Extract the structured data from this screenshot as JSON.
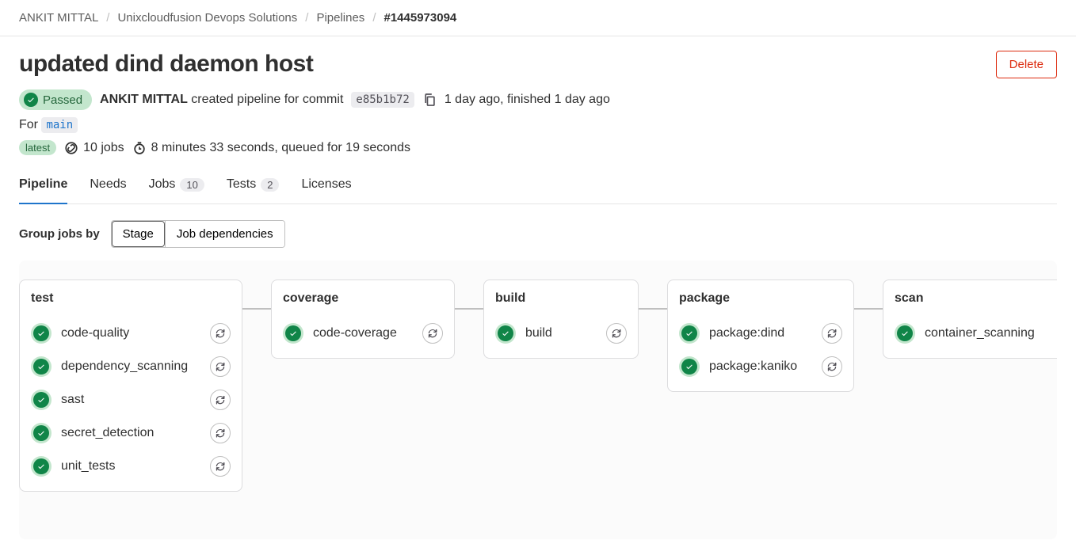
{
  "breadcrumbs": {
    "items": [
      "ANKIT MITTAL",
      "Unixcloudfusion Devops Solutions",
      "Pipelines"
    ],
    "current": "#1445973094"
  },
  "title": "updated dind daemon host",
  "delete_label": "Delete",
  "status_badge": "Passed",
  "author": "ANKIT MITTAL",
  "created_text_a": "created pipeline for commit",
  "commit_sha": "e85b1b72",
  "created_text_b": "1 day ago, finished 1 day ago",
  "for_label": "For",
  "branch": "main",
  "latest_badge": "latest",
  "jobs_count_text": "10 jobs",
  "duration_text": "8 minutes 33 seconds, queued for 19 seconds",
  "tabs": {
    "pipeline": "Pipeline",
    "needs": "Needs",
    "jobs": "Jobs",
    "jobs_count": "10",
    "tests": "Tests",
    "tests_count": "2",
    "licenses": "Licenses"
  },
  "group_by": {
    "label": "Group jobs by",
    "stage": "Stage",
    "deps": "Job dependencies"
  },
  "stages": [
    {
      "name": "test",
      "jobs": [
        "code-quality",
        "dependency_scanning",
        "sast",
        "secret_detection",
        "unit_tests"
      ]
    },
    {
      "name": "coverage",
      "jobs": [
        "code-coverage"
      ]
    },
    {
      "name": "build",
      "jobs": [
        "build"
      ]
    },
    {
      "name": "package",
      "jobs": [
        "package:dind",
        "package:kaniko"
      ]
    },
    {
      "name": "scan",
      "jobs": [
        "container_scanning"
      ]
    }
  ]
}
